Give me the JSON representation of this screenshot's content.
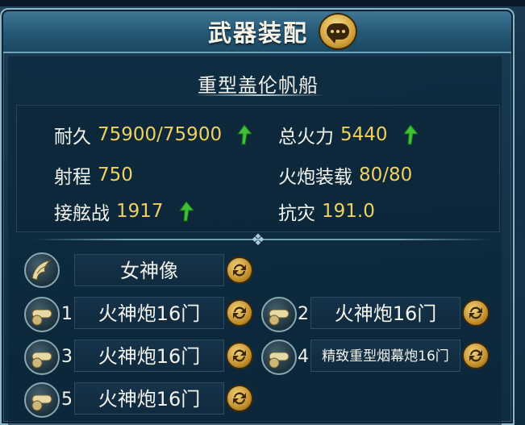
{
  "header": {
    "title": "武器装配",
    "chat_icon": "speech-bubble-icon"
  },
  "ship": {
    "name": "重型盖伦帆船"
  },
  "stats": [
    {
      "label": "耐久",
      "value": "75900/75900",
      "arrow": true
    },
    {
      "label": "总火力",
      "value": "5440",
      "arrow": true
    },
    {
      "label": "射程",
      "value": "750",
      "arrow": false
    },
    {
      "label": "火炮装载",
      "value": "80/80",
      "arrow": false
    },
    {
      "label": "接舷战",
      "value": "1917",
      "arrow": true
    },
    {
      "label": "抗灾",
      "value": "191.0",
      "arrow": false
    }
  ],
  "figurehead": {
    "label": "女神像",
    "icon": "wing-icon"
  },
  "cannons": [
    {
      "num": "1",
      "label": "火神炮16门"
    },
    {
      "num": "2",
      "label": "火神炮16门"
    },
    {
      "num": "3",
      "label": "火神炮16门"
    },
    {
      "num": "4",
      "label": "精致重型烟幕炮16门"
    },
    {
      "num": "5",
      "label": "火神炮16门"
    }
  ],
  "colors": {
    "accent": "#f0d060",
    "up_arrow": "#3fbf3a",
    "text": "#f4f4ee"
  }
}
